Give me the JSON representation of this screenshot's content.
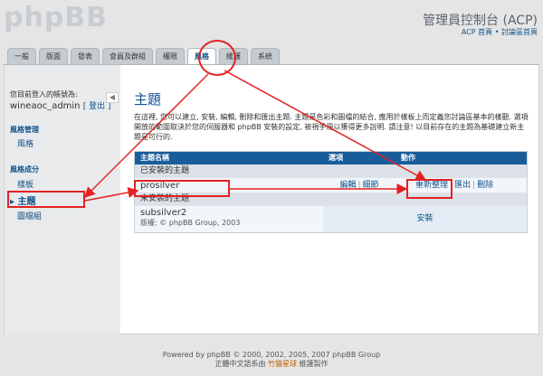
{
  "header": {
    "logo": "phpBB",
    "acp_title": "管理員控制台 (ACP)",
    "links": {
      "acp_home": "ACP 首頁",
      "separator": " • ",
      "forum_home": "討論區首頁"
    }
  },
  "tabs": [
    {
      "label": "一般",
      "active": false
    },
    {
      "label": "版面",
      "active": false
    },
    {
      "label": "發表",
      "active": false
    },
    {
      "label": "會員及群組",
      "active": false
    },
    {
      "label": "權限",
      "active": false
    },
    {
      "label": "風格",
      "active": true
    },
    {
      "label": "維護",
      "active": false
    },
    {
      "label": "系統",
      "active": false
    }
  ],
  "sidebar": {
    "login_label": "您目前登入的帳號為:",
    "username": "wineaoc_admin",
    "logout_label": "[ 登出 ]",
    "collapse_icon": "◀",
    "sections": [
      {
        "title": "風格管理",
        "items": [
          {
            "label": "風格"
          }
        ]
      },
      {
        "title": "風格成分",
        "items": [
          {
            "label": "樣板"
          },
          {
            "label": "主題",
            "active": true
          },
          {
            "label": "圖檔組"
          }
        ]
      }
    ]
  },
  "main": {
    "title": "主題",
    "intro": "在這裡, 您可以建立, 安裝, 編輯, 刪除和匯出主題. 主題是色彩和圖檔的結合, 應用於樣板上而定義您討論區基本的樣觀. 選項開放的範圍取決於您的伺服器和 phpBB 安裝的設定, 被視手冊以獲得更多說明. 請注意! 以目前存在的主題為基礎建立新主題是可行的.",
    "table": {
      "headers": [
        "主題名稱",
        "選項",
        "動作"
      ],
      "installed_label": "已安裝的主題",
      "installed": [
        {
          "name": "prosilver",
          "options": [
            "編輯",
            "細節"
          ],
          "actions": [
            "重新整理",
            "匯出",
            "刪除"
          ]
        }
      ],
      "uninstalled_label": "未安裝的主題",
      "uninstalled": [
        {
          "name": "subsilver2",
          "copyright": "版權: © phpBB Group, 2003",
          "action": "安裝"
        }
      ],
      "separator": "|"
    }
  },
  "footer": {
    "line1": "Powered by phpBB © 2000, 2002, 2005, 2007 phpBB Group",
    "line2_prefix": "正體中文語系由",
    "line2_highlight": "竹貓星球",
    "line2_suffix": "維護製作"
  },
  "colors": {
    "annotation": "#e32222",
    "table_header": "#1a5d9b",
    "link": "#105289"
  }
}
